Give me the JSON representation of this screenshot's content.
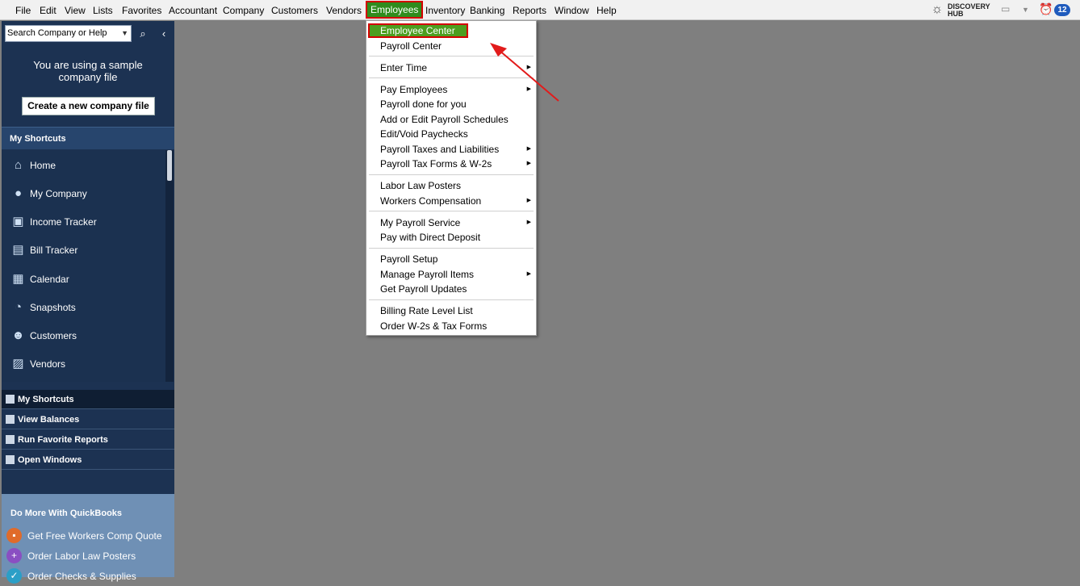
{
  "menubar": {
    "items": [
      "File",
      "Edit",
      "View",
      "Lists",
      "Favorites",
      "Accountant",
      "Company",
      "Customers",
      "Vendors",
      "Employees",
      "Inventory",
      "Banking",
      "Reports",
      "Window",
      "Help"
    ],
    "active": "Employees",
    "hub": {
      "line1": "DISCOVERY",
      "line2": "HUB"
    },
    "badge_count": "12"
  },
  "sidebar": {
    "search_placeholder": "Search Company or Help",
    "sample_text": "You are using a sample company file",
    "create_button": "Create a new company file",
    "shortcuts_header": "My Shortcuts",
    "nav_items": [
      {
        "label": "Home",
        "icon": "home-icon"
      },
      {
        "label": "My Company",
        "icon": "my-company-icon"
      },
      {
        "label": "Income Tracker",
        "icon": "income-tracker-icon"
      },
      {
        "label": "Bill Tracker",
        "icon": "bill-tracker-icon"
      },
      {
        "label": "Calendar",
        "icon": "calendar-icon"
      },
      {
        "label": "Snapshots",
        "icon": "snapshots-icon"
      },
      {
        "label": "Customers",
        "icon": "customers-icon"
      },
      {
        "label": "Vendors",
        "icon": "vendors-icon"
      }
    ],
    "sub_rows": [
      "My Shortcuts",
      "View Balances",
      "Run Favorite Reports",
      "Open Windows"
    ],
    "do_more_header": "Do More With QuickBooks",
    "promos": [
      {
        "label": "Get Free Workers Comp Quote",
        "color": "#e06b2a"
      },
      {
        "label": "Order Labor Law Posters",
        "color": "#8a4fc2"
      },
      {
        "label": "Order Checks & Supplies",
        "color": "#2b9fc7"
      }
    ]
  },
  "dropdown": {
    "items": [
      {
        "label": "Employee Center",
        "submenu": false,
        "highlighted": true
      },
      {
        "label": "Payroll Center",
        "submenu": false
      },
      {
        "label": "Enter Time",
        "submenu": true
      },
      {
        "label": "Pay Employees",
        "submenu": true
      },
      {
        "label": "Payroll done for you",
        "submenu": false
      },
      {
        "label": "Add or Edit Payroll Schedules",
        "submenu": false
      },
      {
        "label": "Edit/Void Paychecks",
        "submenu": false
      },
      {
        "label": "Payroll Taxes and Liabilities",
        "submenu": true
      },
      {
        "label": "Payroll Tax Forms & W-2s",
        "submenu": true
      },
      {
        "label": "Labor Law Posters",
        "submenu": false
      },
      {
        "label": "Workers Compensation",
        "submenu": true
      },
      {
        "label": "My Payroll Service",
        "submenu": true
      },
      {
        "label": "Pay with Direct Deposit",
        "submenu": false
      },
      {
        "label": "Payroll Setup",
        "submenu": false
      },
      {
        "label": "Manage Payroll Items",
        "submenu": true
      },
      {
        "label": "Get Payroll Updates",
        "submenu": false
      },
      {
        "label": "Billing Rate Level List",
        "submenu": false
      },
      {
        "label": "Order W-2s & Tax Forms",
        "submenu": false
      }
    ]
  },
  "colors": {
    "sidebar": "#1c3252",
    "highlight": "#4d9e1f",
    "annotation": "#d40000",
    "workspace": "#7f7f7f"
  }
}
